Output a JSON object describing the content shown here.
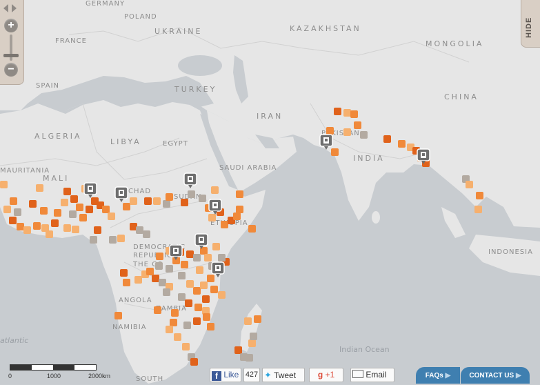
{
  "map": {
    "countries": [
      "GERMANY",
      "POLAND",
      "UKRAINE",
      "KAZAKHSTAN",
      "MONGOLIA",
      "FRANCE",
      "SPAIN",
      "TURKEY",
      "CHINA",
      "IRAN",
      "PAKISTAN",
      "ALGERIA",
      "LIBYA",
      "EGYPT",
      "INDIA",
      "SAUDI ARABIA",
      "MAURITANIA",
      "MALI",
      "CHAD",
      "SUDAN",
      "ETHIOPIA",
      "DEMOCRATIC",
      "REPUBLIC",
      "THE CO",
      "INDONESIA",
      "ANGOLA",
      "ZAMBIA",
      "NAMIBIA",
      "SOUTH"
    ],
    "seas": [
      "Indian Ocean",
      "atlantic"
    ],
    "marker_colors": {
      "dark_orange": "#e0621b",
      "orange": "#f0893a",
      "light_orange": "#f6b06e",
      "gray": "#b3aaa1"
    }
  },
  "controls": {
    "zoom_in": "+",
    "zoom_out": "−",
    "hide_label": "HIDE"
  },
  "scale": {
    "labels": [
      "0",
      "1000",
      "2000km"
    ]
  },
  "social": {
    "like_label": "Like",
    "like_count": "427",
    "tweet_label": "Tweet",
    "gplus_label": "+1",
    "email_label": "Email"
  },
  "footer": {
    "faqs_label": "FAQs",
    "contact_label": "CONTACT US"
  }
}
